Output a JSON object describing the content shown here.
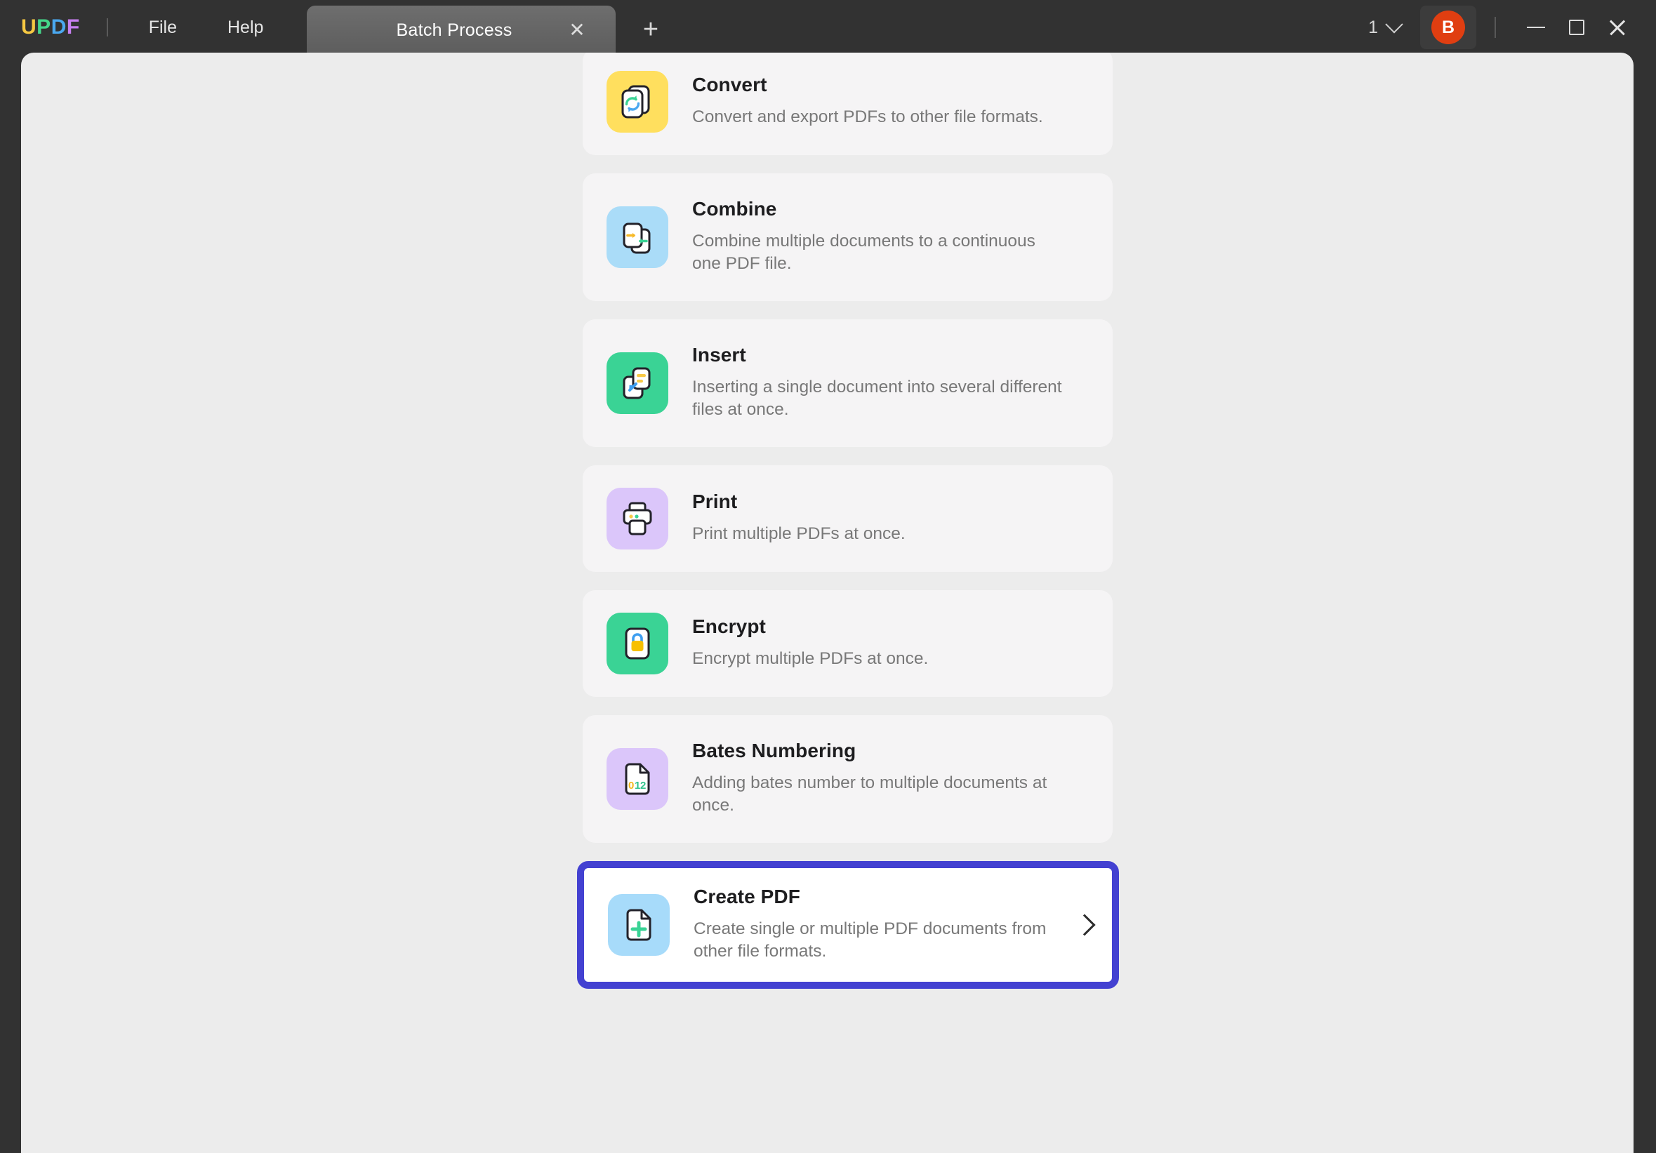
{
  "titlebar": {
    "logo": "UPDF",
    "logo_letters": [
      "U",
      "P",
      "D",
      "F"
    ],
    "menu": [
      {
        "label": "File",
        "name": "menu-file"
      },
      {
        "label": "Help",
        "name": "menu-help"
      }
    ],
    "tab": {
      "label": "Batch Process",
      "close_glyph": "✕",
      "add_glyph": "+"
    },
    "window_count": "1",
    "avatar_initial": "B",
    "accent_avatar_color": "#e03e11"
  },
  "theme": {
    "titlebar_bg": "#323232",
    "content_bg": "#ececec",
    "card_bg": "#f5f4f5",
    "selected_border": "#4341d1",
    "title_color": "#1d1d1f",
    "desc_color": "#787878"
  },
  "main": {
    "cards": [
      {
        "id": "convert",
        "title": "Convert",
        "desc": "Convert and export PDFs to other file formats.",
        "icon_name": "convert-icon",
        "icon_bg": "#ffdf5e",
        "selected": false
      },
      {
        "id": "combine",
        "title": "Combine",
        "desc": "Combine multiple documents to a continuous one PDF file.",
        "icon_name": "combine-icon",
        "icon_bg": "#aadcf8",
        "selected": false
      },
      {
        "id": "insert",
        "title": "Insert",
        "desc": "Inserting a single document into several different files at once.",
        "icon_name": "insert-icon",
        "icon_bg": "#3ad395",
        "selected": false
      },
      {
        "id": "print",
        "title": "Print",
        "desc": "Print multiple PDFs at once.",
        "icon_name": "print-icon",
        "icon_bg": "#dbc6fa",
        "selected": false
      },
      {
        "id": "encrypt",
        "title": "Encrypt",
        "desc": "Encrypt multiple PDFs at once.",
        "icon_name": "encrypt-icon",
        "icon_bg": "#3ad395",
        "selected": false
      },
      {
        "id": "bates-numbering",
        "title": "Bates Numbering",
        "desc": "Adding bates number to multiple documents at once.",
        "icon_name": "bates-numbering-icon",
        "icon_bg": "#dbc6fa",
        "icon_text": "012",
        "selected": false
      },
      {
        "id": "create-pdf",
        "title": "Create PDF",
        "desc": "Create single or multiple PDF documents from other file formats.",
        "icon_name": "create-pdf-icon",
        "icon_bg": "#a7dbfa",
        "selected": true
      }
    ]
  }
}
